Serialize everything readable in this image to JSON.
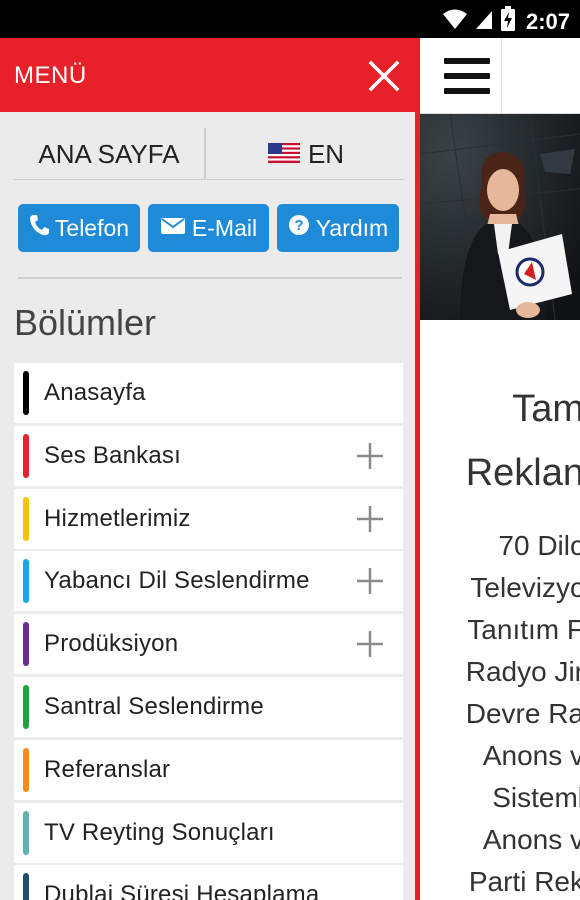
{
  "status_bar": {
    "time": "2:07",
    "icons": [
      "wifi-icon",
      "signal-icon",
      "battery-charging-icon"
    ]
  },
  "drawer": {
    "title": "MENÜ",
    "close_icon": "close-icon",
    "accent_color": "#e8202a",
    "home_label": "ANA SAYFA",
    "language_label": "EN",
    "language_flag": "us-flag-icon",
    "buttons": [
      {
        "label": "Telefon",
        "icon": "phone-icon"
      },
      {
        "label": "E-Mail",
        "icon": "envelope-icon"
      },
      {
        "label": "Yardım",
        "icon": "question-icon"
      }
    ],
    "button_color": "#1f8bd8",
    "section_title": "Bölümler",
    "items": [
      {
        "label": "Anasayfa",
        "color": "#000000",
        "expandable": false
      },
      {
        "label": "Ses Bankası",
        "color": "#e8202a",
        "expandable": true
      },
      {
        "label": "Hizmetlerimiz",
        "color": "#f5c400",
        "expandable": true
      },
      {
        "label": "Yabancı Dil Seslendirme",
        "color": "#1aa7e8",
        "expandable": true
      },
      {
        "label": "Prodüksiyon",
        "color": "#6a2c91",
        "expandable": true
      },
      {
        "label": "Santral Seslendirme",
        "color": "#1fa23a",
        "expandable": false
      },
      {
        "label": "Referanslar",
        "color": "#f28a1e",
        "expandable": false
      },
      {
        "label": "TV Reyting Sonuçları",
        "color": "#5fb3b3",
        "expandable": false
      },
      {
        "label": "Dublaj Süresi Hesaplama",
        "color": "#1f4f6b",
        "expandable": false
      }
    ]
  },
  "page": {
    "menu_icon": "hamburger-icon",
    "lines": [
      "Tam",
      "Reklan",
      "70 Dilc",
      "Televizyc",
      "Tanıtım F",
      "Radyo Jir",
      "Devre Ra",
      "Anons v",
      "Sisteml",
      "Anons v",
      "Parti Rek"
    ]
  }
}
